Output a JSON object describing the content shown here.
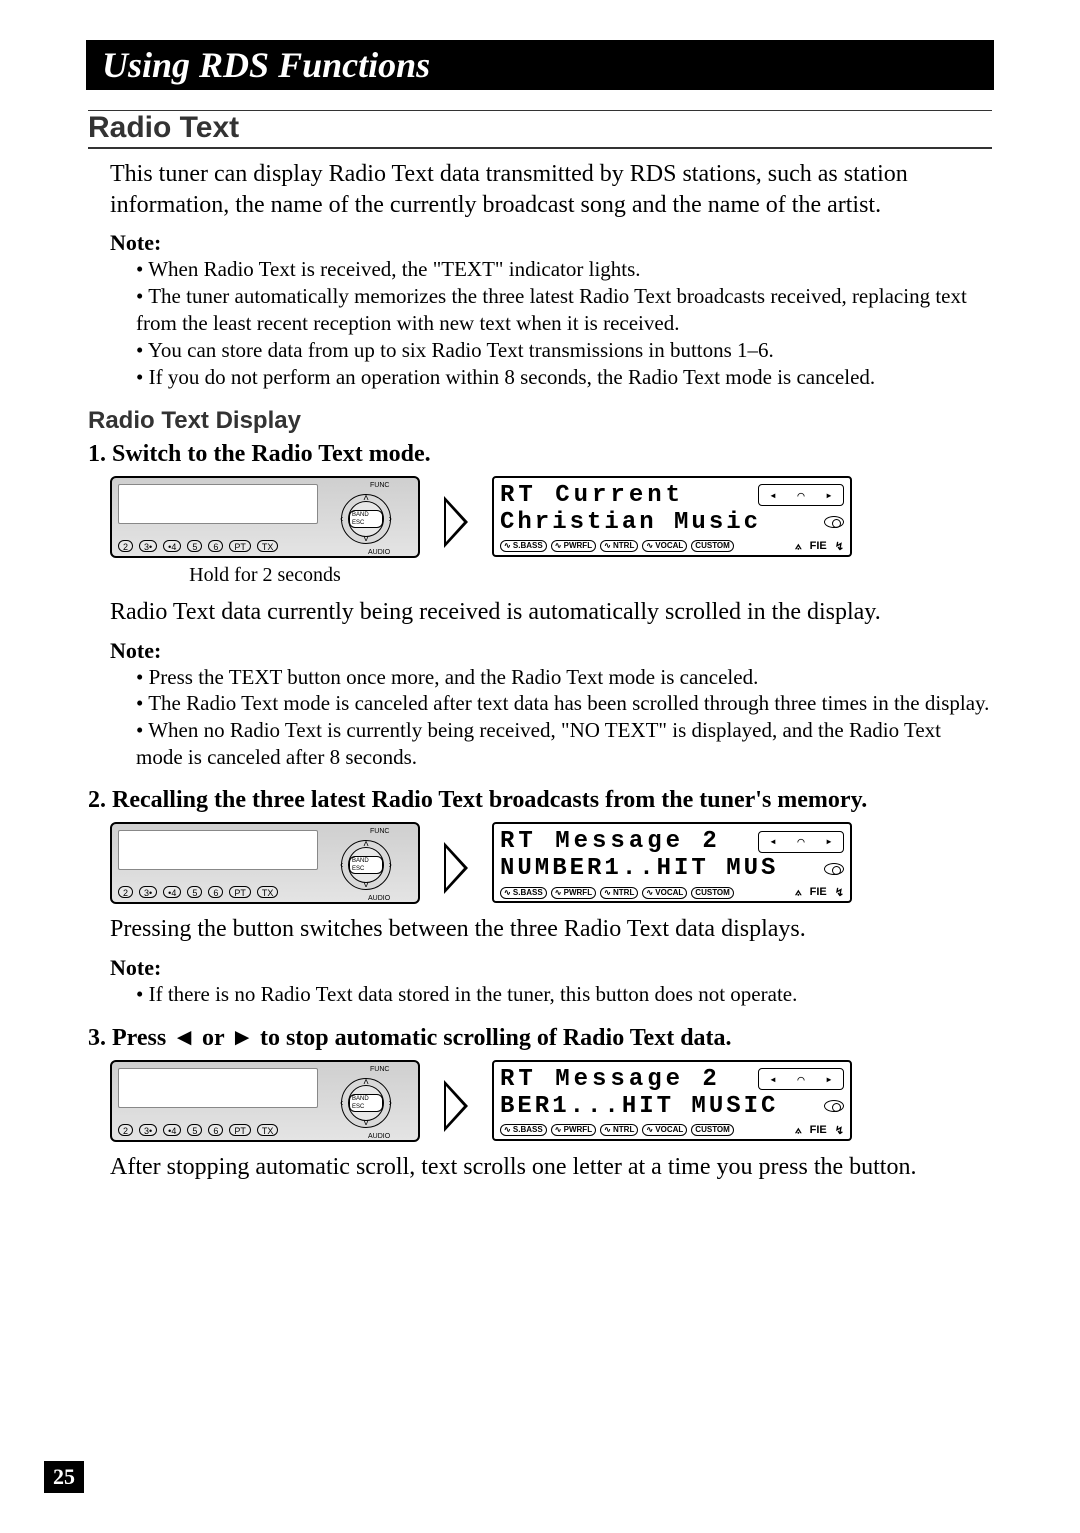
{
  "header": {
    "title": "Using RDS Functions"
  },
  "section_title": "Radio Text",
  "intro": "This tuner can display Radio Text data transmitted by RDS stations, such as station information, the name of the currently broadcast song and the name of the artist.",
  "note1_label": "Note:",
  "note1_items": [
    "When Radio Text is received, the \"TEXT\" indicator lights.",
    "The tuner automatically memorizes the three latest Radio Text broadcasts received, replacing text from the least recent reception with new text when it is received.",
    "You can store data from up to six Radio Text transmissions in buttons 1–6.",
    "If you do not perform an operation within 8 seconds, the Radio Text mode is canceled."
  ],
  "subsection_title": "Radio Text Display",
  "steps": [
    {
      "num": "1.",
      "title": "Switch to the Radio Text mode.",
      "panel_buttons": [
        "2",
        "3•",
        "•4",
        "5",
        "6",
        "PT",
        "TX"
      ],
      "panel_knob": "BAND ESC",
      "panel_func": "FUNC",
      "panel_audio": "AUDIO",
      "caption": "Hold for 2 seconds",
      "lcd_line1": "RT Current",
      "lcd_line2": "Christian Music",
      "lcd_tags": [
        "∿ S.BASS",
        "∿ PWRFL",
        "∿ NTRL",
        "∿ VOCAL",
        "CUSTOM"
      ],
      "lcd_fie": "FIE",
      "body_after": "Radio Text data currently being received is automatically scrolled in the display.",
      "note_label": "Note:",
      "note_items": [
        "Press the TEXT button once more, and the Radio Text mode is canceled.",
        "The Radio Text mode is canceled after text data has been scrolled through three times in the display.",
        "When no Radio Text is currently being received, \"NO TEXT\" is displayed, and the Radio Text mode is canceled after 8 seconds."
      ]
    },
    {
      "num": "2.",
      "title": "Recalling the three latest Radio Text broadcasts from the tuner's memory.",
      "panel_buttons": [
        "2",
        "3•",
        "•4",
        "5",
        "6",
        "PT",
        "TX"
      ],
      "panel_knob": "BAND ESC",
      "panel_func": "FUNC",
      "panel_audio": "AUDIO",
      "lcd_line1": "RT Message 2",
      "lcd_line2": "NUMBER1..HIT MUS",
      "lcd_tags": [
        "∿ S.BASS",
        "∿ PWRFL",
        "∿ NTRL",
        "∿ VOCAL",
        "CUSTOM"
      ],
      "lcd_fie": "FIE",
      "body_after": "Pressing the button switches between the three Radio Text data displays.",
      "note_label": "Note:",
      "note_items": [
        "If there is no Radio Text data stored in the tuner, this button does not operate."
      ]
    },
    {
      "num": "3.",
      "title_pre": "Press ",
      "title_mid": " or ",
      "title_post": " to stop automatic scrolling of Radio Text data.",
      "left_glyph": "◄",
      "right_glyph": "►",
      "panel_buttons": [
        "2",
        "3•",
        "•4",
        "5",
        "6",
        "PT",
        "TX"
      ],
      "panel_knob": "BAND ESC",
      "panel_func": "FUNC",
      "panel_audio": "AUDIO",
      "lcd_line1": "RT Message 2",
      "lcd_line2": "BER1...HIT MUSIC",
      "lcd_tags": [
        "∿ S.BASS",
        "∿ PWRFL",
        "∿ NTRL",
        "∿ VOCAL",
        "CUSTOM"
      ],
      "lcd_fie": "FIE",
      "body_after": "After stopping automatic scroll, text scrolls one letter at a time you press the button."
    }
  ],
  "page_number": "25"
}
